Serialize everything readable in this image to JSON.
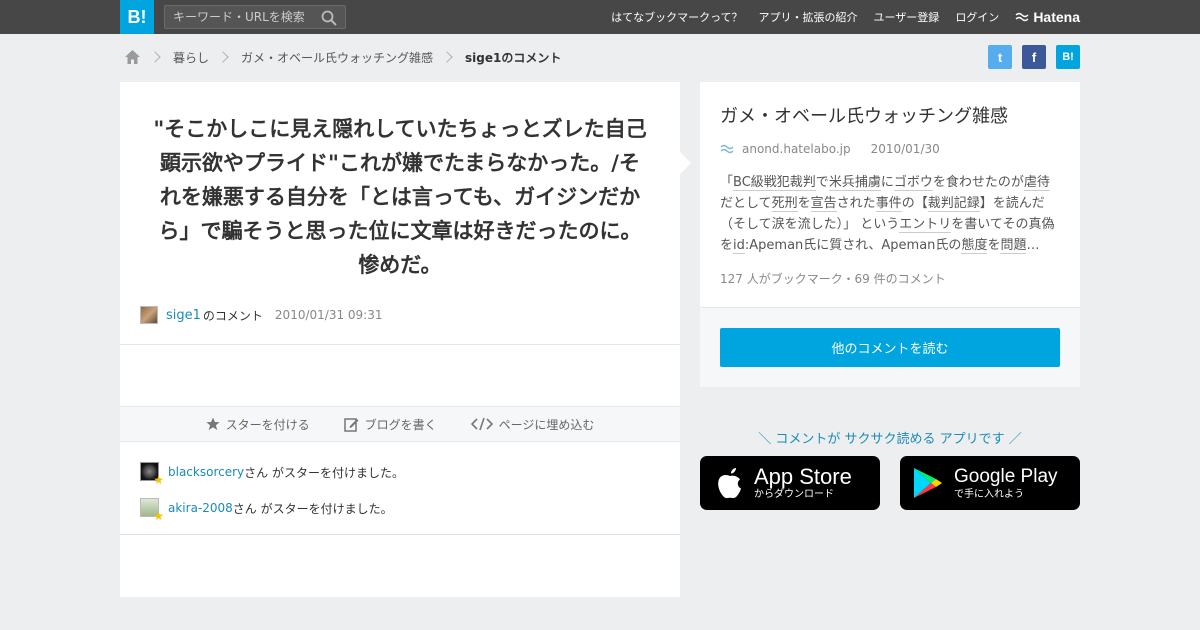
{
  "header": {
    "logo": "B!",
    "search_placeholder": "キーワード・URLを検索",
    "nav": [
      "はてなブックマークって？",
      "アプリ・拡張の紹介",
      "ユーザー登録",
      "ログイン"
    ],
    "brand": "Hatena"
  },
  "breadcrumb": {
    "items": [
      "暮らし",
      "ガメ・オベール氏ウォッチング雑感"
    ],
    "current": "sige1のコメント"
  },
  "share": {
    "twitter": "t",
    "facebook": "f",
    "hatena": "B!",
    "colors": {
      "twitter": "#55acee",
      "facebook": "#3b5998",
      "hatena": "#00a4de"
    }
  },
  "comment": {
    "text": "\"そこかしこに見え隠れしていたちょっとズレた自己顕示欲やプライド\"これが嫌でたまらなかった。/それを嫌悪する自分を「とは言っても、ガイジンだから」で騙そうと思った位に文章は好きだったのに。惨めだ。",
    "user": "sige1",
    "suffix": "のコメント",
    "date": "2010/01/31 09:31"
  },
  "actions": [
    "スターを付ける",
    "ブログを書く",
    "ページに埋め込む"
  ],
  "stars": [
    {
      "user": "blacksorcery",
      "text": "さん がスターを付けました。"
    },
    {
      "user": "akira-2008",
      "text": "さん がスターを付けました。"
    }
  ],
  "entry": {
    "title": "ガメ・オベール氏ウォッチング雑感",
    "domain": "anond.hatelabo.jp",
    "date": "2010/01/30",
    "excerpt_parts": [
      {
        "t": "「",
        "u": false
      },
      {
        "t": "BC級戦犯裁判",
        "u": true
      },
      {
        "t": "で",
        "u": false
      },
      {
        "t": "米兵捕虜",
        "u": true
      },
      {
        "t": "に",
        "u": false
      },
      {
        "t": "ゴボウ",
        "u": true
      },
      {
        "t": "を食わせたのが",
        "u": false
      },
      {
        "t": "虐待",
        "u": true
      },
      {
        "t": "だとして",
        "u": false
      },
      {
        "t": "死刑",
        "u": true
      },
      {
        "t": "を",
        "u": false
      },
      {
        "t": "宣告",
        "u": true
      },
      {
        "t": "された",
        "u": false
      },
      {
        "t": "事件",
        "u": true
      },
      {
        "t": "の【",
        "u": false
      },
      {
        "t": "裁判記録",
        "u": true
      },
      {
        "t": "】を読んだ（そして涙を流した）」 という",
        "u": false
      },
      {
        "t": "エントリ",
        "u": true
      },
      {
        "t": "を書いてその真偽を",
        "u": false
      },
      {
        "t": "id",
        "u": true
      },
      {
        "t": ":Apeman氏に質され、Apeman氏の",
        "u": false
      },
      {
        "t": "態度",
        "u": true
      },
      {
        "t": "を",
        "u": false
      },
      {
        "t": "問題",
        "u": true
      },
      {
        "t": "…",
        "u": false
      }
    ],
    "counts": "127 人がブックマーク・69 件のコメント",
    "button": "他のコメントを読む"
  },
  "promo": {
    "tagline": "＼ コメントが サクサク読める アプリです ／",
    "appstore_big": "App Store",
    "appstore_small": "からダウンロード",
    "googleplay_big": "Google Play",
    "googleplay_small": "で手に入れよう"
  }
}
